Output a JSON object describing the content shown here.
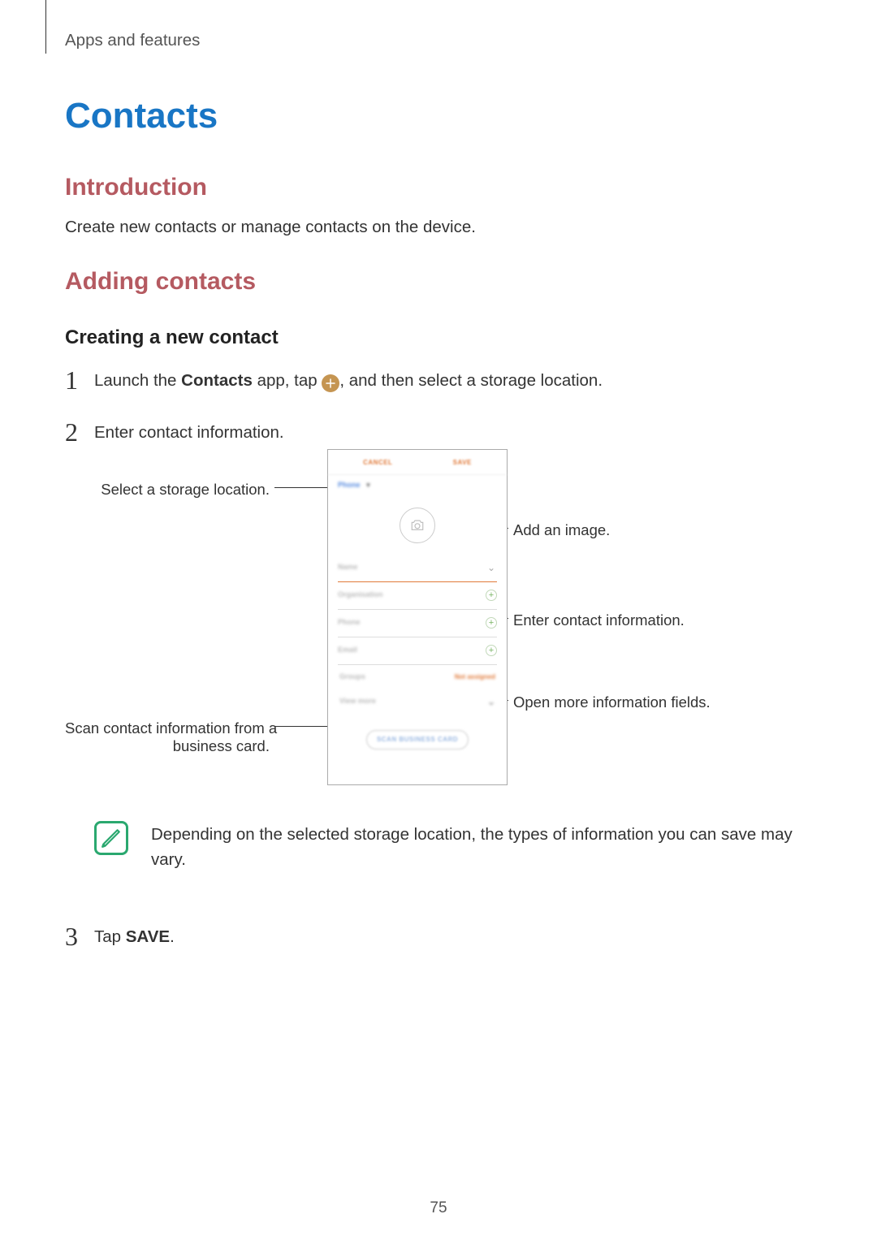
{
  "header": {
    "breadcrumb": "Apps and features"
  },
  "title": "Contacts",
  "intro": {
    "heading": "Introduction",
    "text": "Create new contacts or manage contacts on the device."
  },
  "adding": {
    "heading": "Adding contacts",
    "sub": "Creating a new contact",
    "step1_a": "Launch the ",
    "step1_b": "Contacts",
    "step1_c": " app, tap ",
    "step1_d": ", and then select a storage location.",
    "step2": "Enter contact information.",
    "step3_a": "Tap ",
    "step3_b": "SAVE",
    "step3_c": "."
  },
  "callouts": {
    "storage": "Select a storage location.",
    "image": "Add an image.",
    "enter": "Enter contact information.",
    "more": "Open more information fields.",
    "scan1": "Scan contact information from a",
    "scan2": "business card."
  },
  "phone": {
    "cancel": "CANCEL",
    "save": "SAVE",
    "storage": "Phone",
    "name": "Name",
    "org": "Organisation",
    "phone": "Phone",
    "email": "Email",
    "groups": "Groups",
    "groups_val": "Not assigned",
    "more": "View more",
    "scan": "SCAN BUSINESS CARD"
  },
  "note": "Depending on the selected storage location, the types of information you can save may vary.",
  "page_number": "75"
}
